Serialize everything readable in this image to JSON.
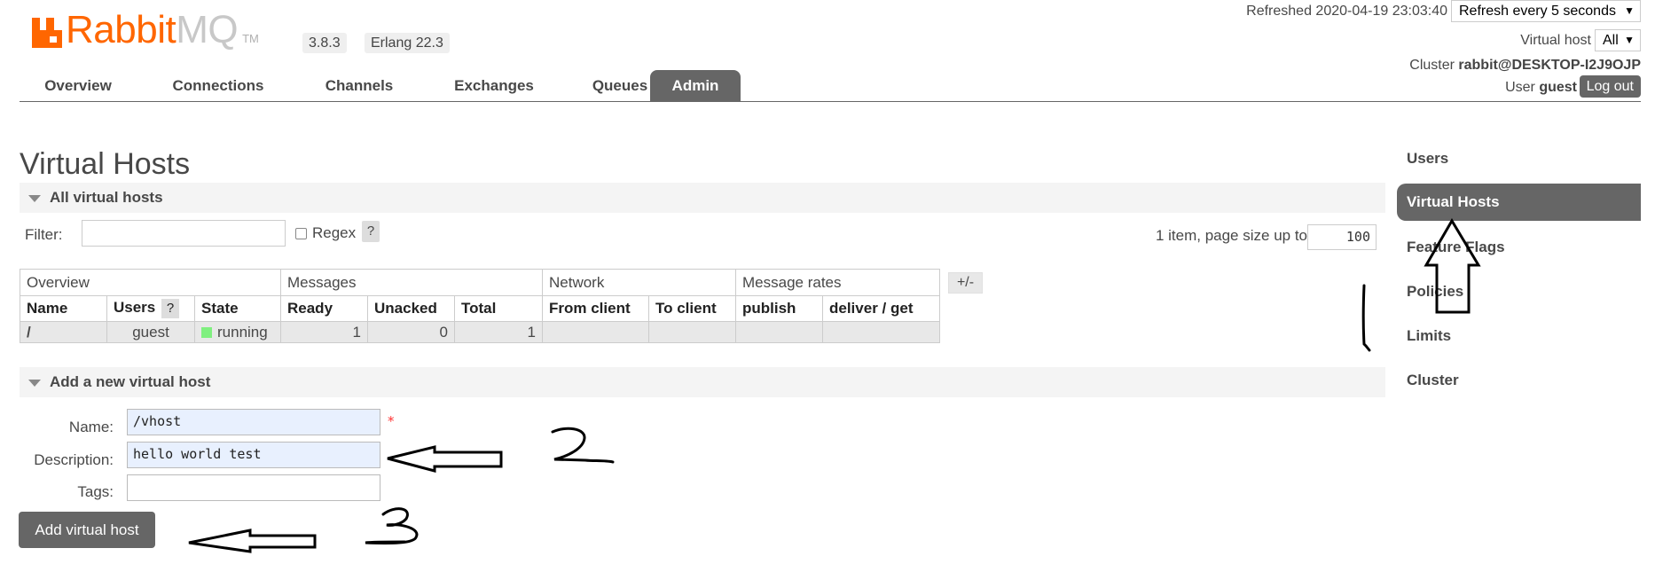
{
  "header": {
    "logo_rabbit": "Rabbit",
    "logo_mq": "MQ",
    "logo_tm": "TM",
    "version": "3.8.3",
    "erlang": "Erlang 22.3",
    "refreshed": "Refreshed 2020-04-19 23:03:40",
    "refresh_option": "Refresh every 5 seconds",
    "vhost_label": "Virtual host",
    "vhost_option": "All",
    "cluster_label": "Cluster",
    "cluster_name": "rabbit@DESKTOP-I2J9OJP",
    "user_label": "User",
    "user_name": "guest",
    "logout": "Log out"
  },
  "nav": {
    "tabs": [
      {
        "label": "Overview"
      },
      {
        "label": "Connections"
      },
      {
        "label": "Channels"
      },
      {
        "label": "Exchanges"
      },
      {
        "label": "Queues"
      },
      {
        "label": "Admin",
        "active": true
      }
    ]
  },
  "page": {
    "title": "Virtual Hosts",
    "all_section": "All virtual hosts",
    "filter_label": "Filter:",
    "regex_label": "Regex",
    "help": "?",
    "page_info": "1 item, page size up to",
    "page_size": "100",
    "plus_minus": "+/-"
  },
  "table": {
    "groups": [
      "Overview",
      "Messages",
      "Network",
      "Message rates"
    ],
    "columns": [
      "Name",
      "Users",
      "State",
      "Ready",
      "Unacked",
      "Total",
      "From client",
      "To client",
      "publish",
      "deliver / get"
    ],
    "rows": [
      {
        "name": "/",
        "users": "guest",
        "state": "running",
        "ready": "1",
        "unacked": "0",
        "total": "1",
        "from_client": "",
        "to_client": "",
        "publish": "",
        "deliver_get": ""
      }
    ]
  },
  "form": {
    "section": "Add a new virtual host",
    "name_label": "Name:",
    "name_value": "/vhost",
    "required": "*",
    "description_label": "Description:",
    "description_value": "hello world test",
    "tags_label": "Tags:",
    "tags_value": "",
    "submit": "Add virtual host"
  },
  "sidebar": {
    "items": [
      {
        "label": "Users"
      },
      {
        "label": "Virtual Hosts",
        "active": true
      },
      {
        "label": "Feature Flags"
      },
      {
        "label": "Policies"
      },
      {
        "label": "Limits"
      },
      {
        "label": "Cluster"
      }
    ]
  },
  "colors": {
    "brand_orange": "#ff6600",
    "active_tab": "#666666",
    "running": "#80f080"
  }
}
